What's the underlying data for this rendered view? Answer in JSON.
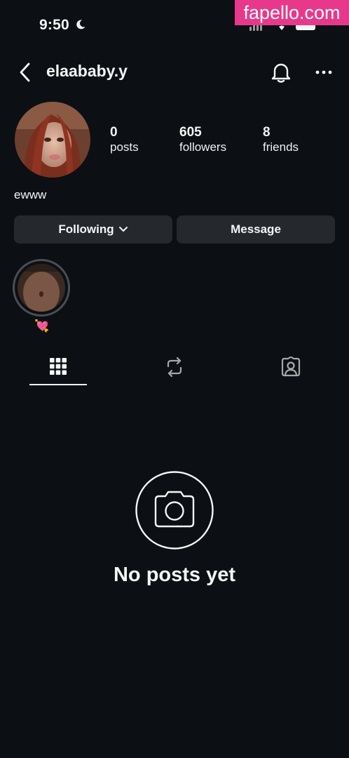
{
  "status": {
    "time": "9:50",
    "moon_icon": "moon-icon"
  },
  "watermark": {
    "text": "fapello.com"
  },
  "header": {
    "username": "elaababy.y",
    "icons": [
      "back-arrow-icon",
      "bell-icon",
      "more-horizontal-icon"
    ]
  },
  "stats": {
    "posts": {
      "count": "0",
      "label": "posts"
    },
    "followers": {
      "count": "605",
      "label": "followers"
    },
    "friends": {
      "count": "8",
      "label": "friends"
    }
  },
  "bio": "ewww",
  "actions": {
    "following_label": "Following",
    "message_label": "Message"
  },
  "highlight": {
    "label_emoji": "💘"
  },
  "tabs": {
    "icons": [
      "grid-icon",
      "reposts-icon",
      "tagged-icon"
    ],
    "active": 0
  },
  "empty": {
    "text": "No posts yet",
    "icon": "camera-icon"
  },
  "colors": {
    "background": "#0c1014",
    "button": "#25292e",
    "watermark": "#e8388b"
  }
}
